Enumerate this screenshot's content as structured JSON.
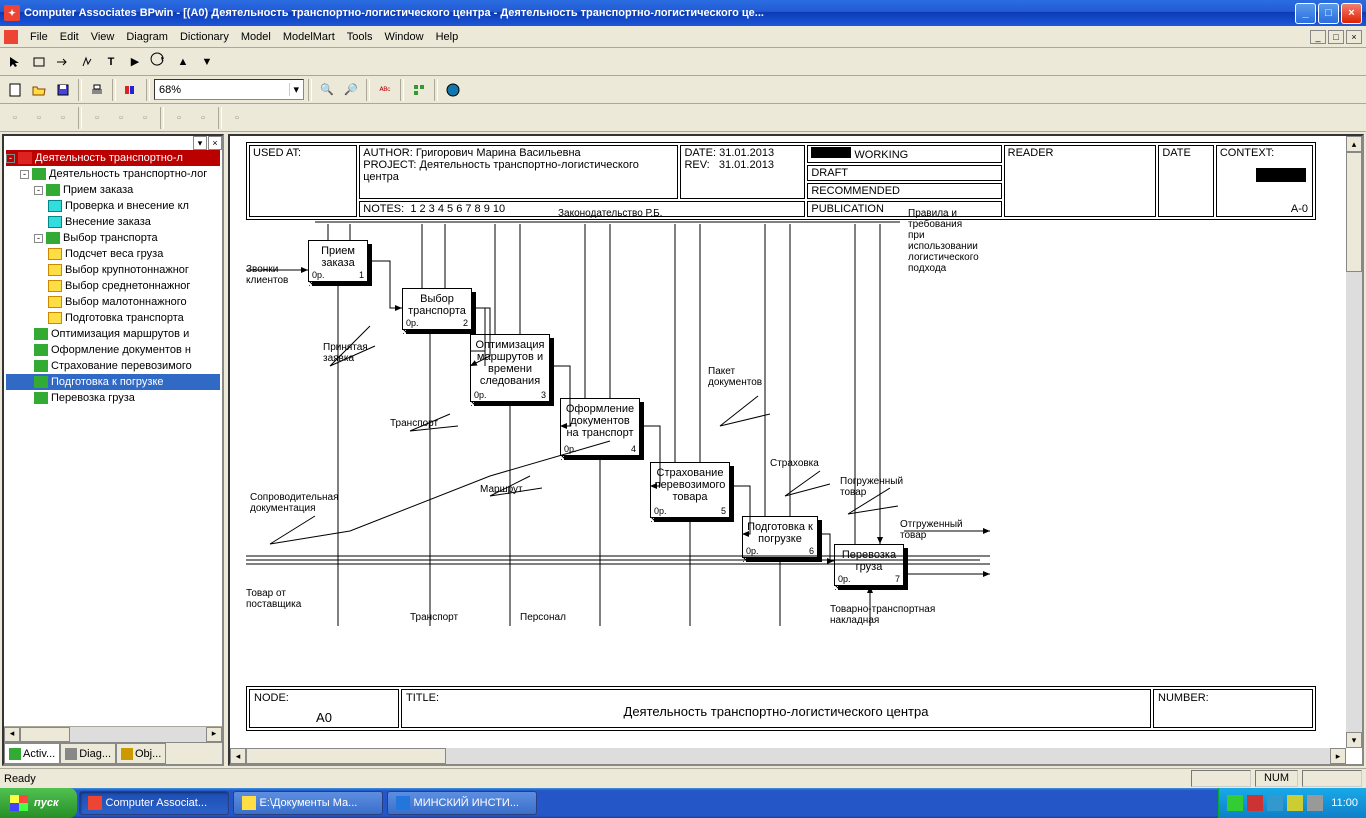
{
  "window": {
    "title": "Computer Associates BPwin - [(A0) Деятельность  транспортно-логистического  центра - Деятельность транспортно-логистического це..."
  },
  "menu": [
    "File",
    "Edit",
    "View",
    "Diagram",
    "Dictionary",
    "Model",
    "ModelMart",
    "Tools",
    "Window",
    "Help"
  ],
  "zoom": "68%",
  "tree": {
    "root": "Деятельность транспортно-л",
    "n0": "Деятельность транспортно-лог",
    "priem": "Прием заказа",
    "priem1": "Проверка и внесение кл",
    "priem2": "Внесение заказа",
    "vybor": "Выбор транспорта",
    "vybor1": "Подсчет веса груза",
    "vybor2": "Выбор крупнотоннажног",
    "vybor3": "Выбор среднетоннажног",
    "vybor4": "Выбор малотоннажного",
    "vybor5": "Подготовка транспорта",
    "opt": "Оптимизация маршрутов и",
    "oform": "Оформление документов н",
    "strah": "Страхование перевозимого",
    "podg": "Подготовка к погрузке",
    "perev": "Перевозка груза"
  },
  "tabs": {
    "t1": "Activ...",
    "t2": "Diag...",
    "t3": "Obj..."
  },
  "header": {
    "used_at": "USED AT:",
    "author_l": "AUTHOR:",
    "author": "Григорович Марина Васильевна",
    "project_l": "PROJECT:",
    "project": "Деятельность транспортно-логистического центра",
    "date_l": "DATE:",
    "date": "31.01.2013",
    "rev_l": "REV:",
    "rev": "31.01.2013",
    "working": "WORKING",
    "draft": "DRAFT",
    "recommended": "RECOMMENDED",
    "publication": "PUBLICATION",
    "reader": "READER",
    "rdate": "DATE",
    "context": "CONTEXT:",
    "notes_l": "NOTES:",
    "notes": "1  2  3  4  5  6  7  8  9  10",
    "ctx_node": "A-0"
  },
  "footer": {
    "node_l": "NODE:",
    "node": "A0",
    "title_l": "TITLE:",
    "title": "Деятельность  транспортно-логистического центра",
    "number_l": "NUMBER:"
  },
  "boxes": {
    "b1": {
      "t": "Прием\nзаказа",
      "n": "1"
    },
    "b2": {
      "t": "Выбор\nтранспорта",
      "n": "2"
    },
    "b3": {
      "t": "Оптимизация\nмаршрутов\nи времени\nследования",
      "n": "3"
    },
    "b4": {
      "t": "Оформление\nдокументов\nна транспорт",
      "n": "4"
    },
    "b5": {
      "t": "Страхование\nперевозимого\nтовара",
      "n": "5"
    },
    "b6": {
      "t": "Подготовка\nк погрузке",
      "n": "6"
    },
    "b7": {
      "t": "Перевозка\nгруза",
      "n": "7"
    },
    "rp": "0р."
  },
  "labels": {
    "zakon": "Законодательство Р.Б.",
    "pravila": "Правила и\nтребования\nпри\nиспользовании\nлогистического\nподхода",
    "zvonki": "Звонки\nклиентов",
    "zayavka": "Принятая\nзаявка",
    "transport1": "Транспорт",
    "marshrut": "Маршрут",
    "paket": "Пакет\nдокументов",
    "strahovka": "Страховка",
    "pogruzh": "Погруженный\nтовар",
    "otgruzh": "Отгруженный\nтовар",
    "soprov": "Сопроводительная\nдокументация",
    "tovar_post": "Товар от\nпоставщика",
    "transport2": "Транспорт",
    "personal": "Персонал",
    "ttn": "Товарно-транспортная\nнакладная"
  },
  "status": {
    "ready": "Ready",
    "num": "NUM"
  },
  "taskbar": {
    "start": "пуск",
    "t1": "Computer Associat...",
    "t2": "E:\\Документы Ма...",
    "t3": "МИНСКИЙ ИНСТИ...",
    "clock": "11:00"
  }
}
